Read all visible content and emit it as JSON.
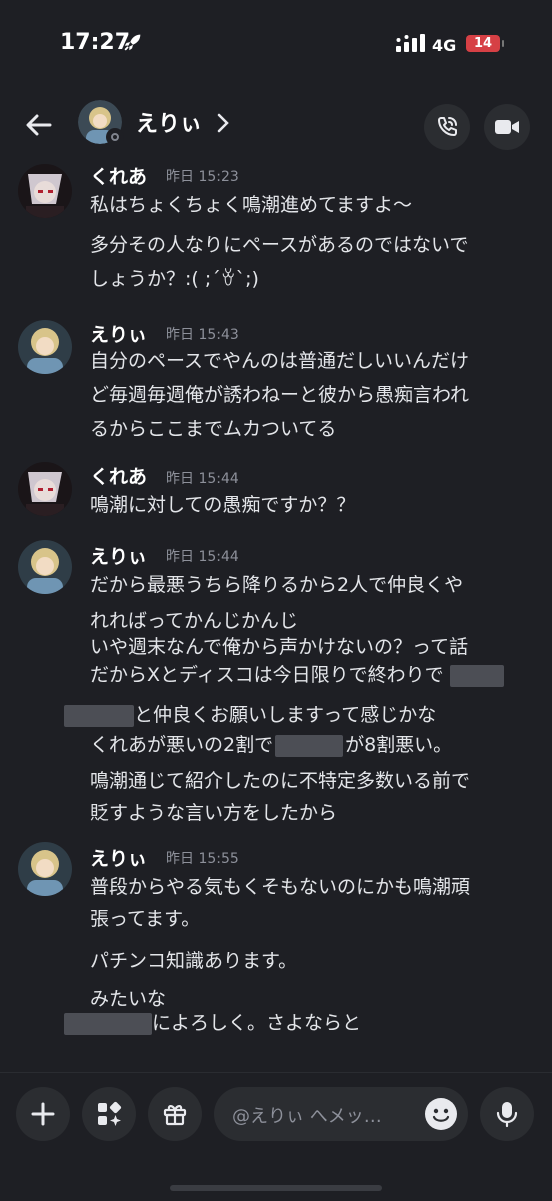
{
  "status_bar": {
    "time": "17:27",
    "network": "4G",
    "battery": "14"
  },
  "header": {
    "name": "えりぃ",
    "chevron": "›"
  },
  "messages": [
    {
      "author": "くれあ",
      "timestamp": "昨日 15:23",
      "lines": [
        "私はちょくちょく鳴潮進めてますよ〜",
        "多分その人なりにペースがあるのではないで",
        "しょうか？:( ;´ꈊ`;)"
      ]
    },
    {
      "author": "えりぃ",
      "timestamp": "昨日 15:43",
      "lines": [
        "自分のペースでやんのは普通だしいいんだけ",
        "ど毎週毎週俺が誘わねーと彼から愚痴言われ",
        "るからここまでムカついてる"
      ]
    },
    {
      "author": "くれあ",
      "timestamp": "昨日 15:44",
      "lines": [
        "鳴潮に対しての愚痴ですか？？"
      ]
    },
    {
      "author": "えりぃ",
      "timestamp": "昨日 15:44",
      "lines": [
        "だから最悪うちら降りるから2人で仲良くや",
        "れればってかんじかんじ",
        "いや週末なんで俺から声かけないの？って話",
        "だからXとディスコは今日限りで終わりで",
        "と仲良くお願いしますって感じかな",
        "くれあが悪いの2割で",
        "が8割悪い。",
        "鳴潮通じて紹介したのに不特定多数いる前で",
        "貶すような言い方をしたから"
      ]
    },
    {
      "author": "えりぃ",
      "timestamp": "昨日 15:55",
      "lines": [
        "普段からやる気もくそもないのにかも鳴潮頑",
        "張ってます。",
        "パチンコ知識あります。",
        "みたいな",
        "によろしく。さよならと"
      ]
    }
  ],
  "composer": {
    "placeholder": "@えりぃ へメッ…"
  },
  "colors": {
    "background": "#1e1f24",
    "button_bg": "#2b2d31",
    "timestamp": "#8d909a",
    "battery": "#d64045"
  },
  "icons": [
    "rocket-icon",
    "signal-icon",
    "back-arrow-icon",
    "chevron-right-icon",
    "phone-call-icon",
    "video-camera-icon",
    "plus-icon",
    "apps-icon",
    "gift-icon",
    "emoji-icon",
    "microphone-icon"
  ]
}
